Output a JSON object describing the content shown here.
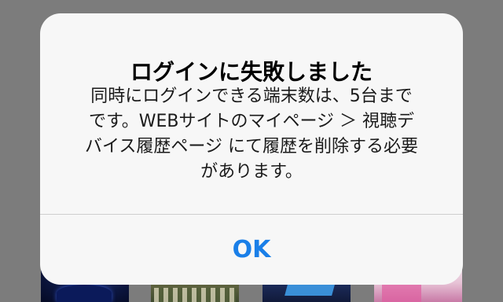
{
  "alert": {
    "title": "ログインに失敗しました",
    "message_lines": [
      "同時にログインできる端末数は、5台まで",
      "です。WEBサイトのマイページ ＞ 視聴デ",
      "バイス履歴ページ にて履歴を削除する必要",
      "があります。"
    ],
    "ok_label": "OK",
    "button_color": "#1a7fe8",
    "background_color": "#f7f7f7"
  },
  "background": {
    "thumbnails": [
      {
        "icon": "starry-night-thumbnail"
      },
      {
        "icon": "team-photo-thumbnail"
      },
      {
        "icon": "magazine-cover-thumbnail"
      },
      {
        "icon": "pink-magazine-thumbnail"
      }
    ]
  }
}
